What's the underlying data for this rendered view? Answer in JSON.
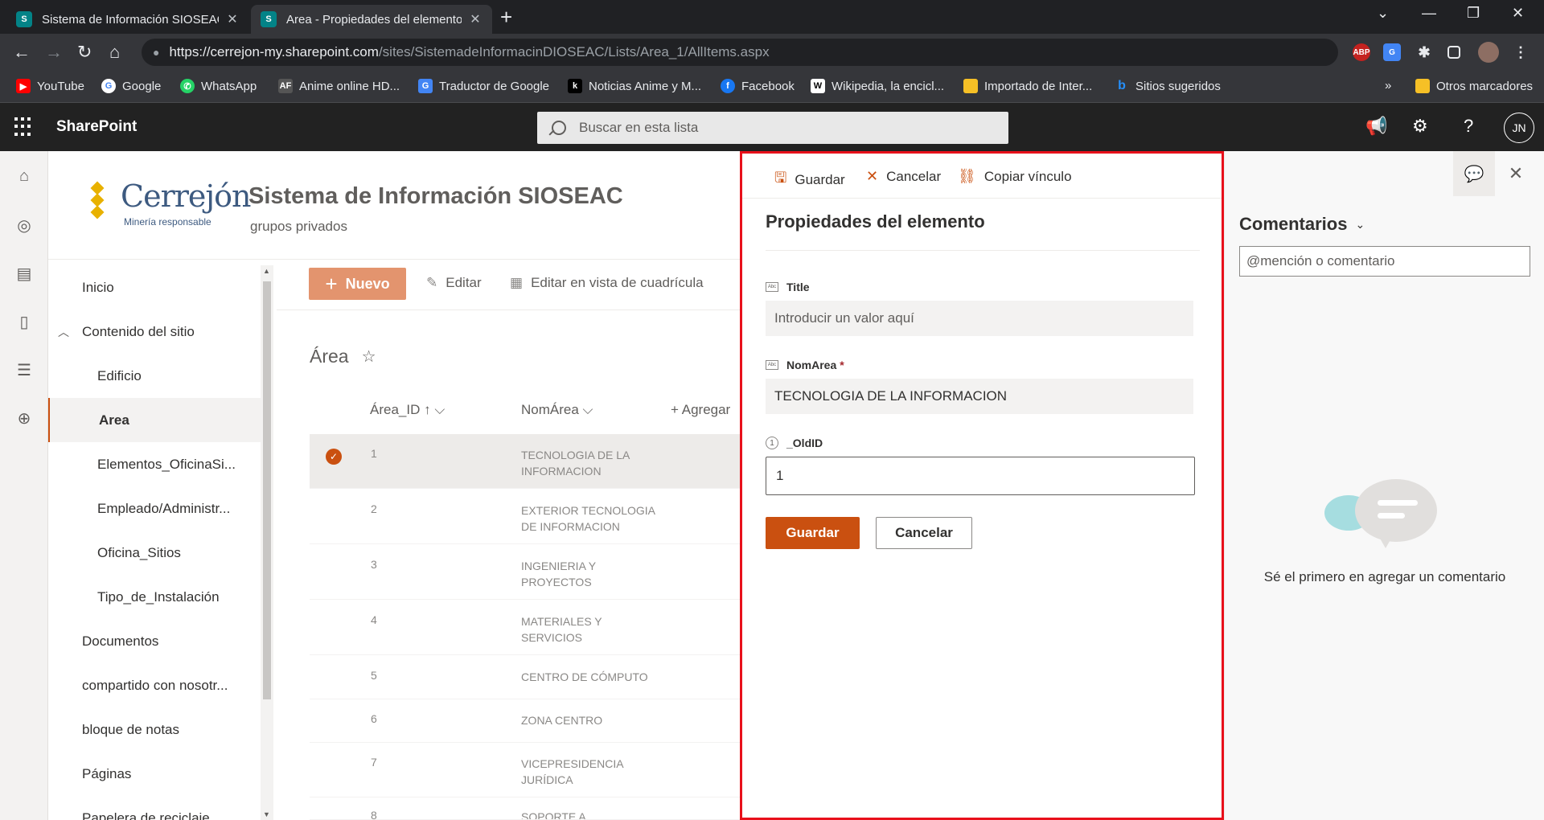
{
  "browser": {
    "tabs": [
      {
        "title": "Sistema de Información SIOSEAC",
        "favicon": "S"
      },
      {
        "title": "Area - Propiedades del elemento",
        "favicon": "S"
      }
    ],
    "url_host": "https://cerrejon-my.sharepoint.com",
    "url_path": "/sites/SistemadeInformacinDIOSEAC/Lists/Area_1/AllItems.aspx",
    "bookmarks": [
      "YouTube",
      "Google",
      "WhatsApp",
      "Anime online HD...",
      "Traductor de Google",
      "Noticias Anime y M...",
      "Facebook",
      "Wikipedia, la encicl...",
      "Importado de Inter...",
      "Sitios sugeridos"
    ],
    "bookmarks_more": "»",
    "other_bookmarks": "Otros marcadores",
    "ext_abp": "ABP"
  },
  "sp_header": {
    "brand": "SharePoint",
    "search_placeholder": "Buscar en esta lista",
    "avatar": "JN"
  },
  "site": {
    "logo_word": "errejón",
    "logo_tag": "Minería responsable",
    "title": "Sistema de Información SIOSEAC",
    "subtitle": "grupos privados"
  },
  "leftnav": [
    "Inicio",
    "Contenido del sitio",
    "Edificio",
    "Area",
    "Elementos_OficinaSi...",
    "Empleado/Administr...",
    "Oficina_Sitios",
    "Tipo_de_Instalación",
    "Documentos",
    "compartido con nosotr...",
    "bloque de notas",
    "Páginas",
    "Papelera de reciclaje"
  ],
  "commandbar": {
    "new": "Nuevo",
    "edit": "Editar",
    "grid": "Editar en vista de cuadrícula"
  },
  "list": {
    "title": "Área",
    "columns": {
      "id": "Área_ID",
      "nom": "NomÁrea",
      "add": "Agregar"
    },
    "rows": [
      {
        "id": "1",
        "nom": "TECNOLOGIA DE LA INFORMACION"
      },
      {
        "id": "2",
        "nom": "EXTERIOR TECNOLOGIA DE INFORMACION"
      },
      {
        "id": "3",
        "nom": "INGENIERIA Y PROYECTOS"
      },
      {
        "id": "4",
        "nom": "MATERIALES Y SERVICIOS"
      },
      {
        "id": "5",
        "nom": "CENTRO DE CÓMPUTO"
      },
      {
        "id": "6",
        "nom": "ZONA CENTRO"
      },
      {
        "id": "7",
        "nom": "VICEPRESIDENCIA JURÍDICA"
      },
      {
        "id": "8",
        "nom": "SOPORTE A"
      }
    ]
  },
  "panel": {
    "toolbar": {
      "save": "Guardar",
      "cancel": "Cancelar",
      "copy": "Copiar vínculo"
    },
    "title": "Propiedades del elemento",
    "fields": {
      "title_label": "Title",
      "title_placeholder": "Introducir un valor aquí",
      "nomarea_label": "NomArea",
      "nomarea_required": "*",
      "nomarea_value": "TECNOLOGIA DE LA INFORMACION",
      "oldid_label": "_OldID",
      "oldid_value": "1"
    },
    "save_button": "Guardar",
    "cancel_button": "Cancelar"
  },
  "comments": {
    "title": "Comentarios",
    "input_placeholder": "@mención o comentario",
    "empty_text": "Sé el primero en agregar un comentario"
  },
  "colors": {
    "accent": "#ca5010",
    "highlight_border": "#e8101b",
    "new_button": "#e3946e"
  }
}
